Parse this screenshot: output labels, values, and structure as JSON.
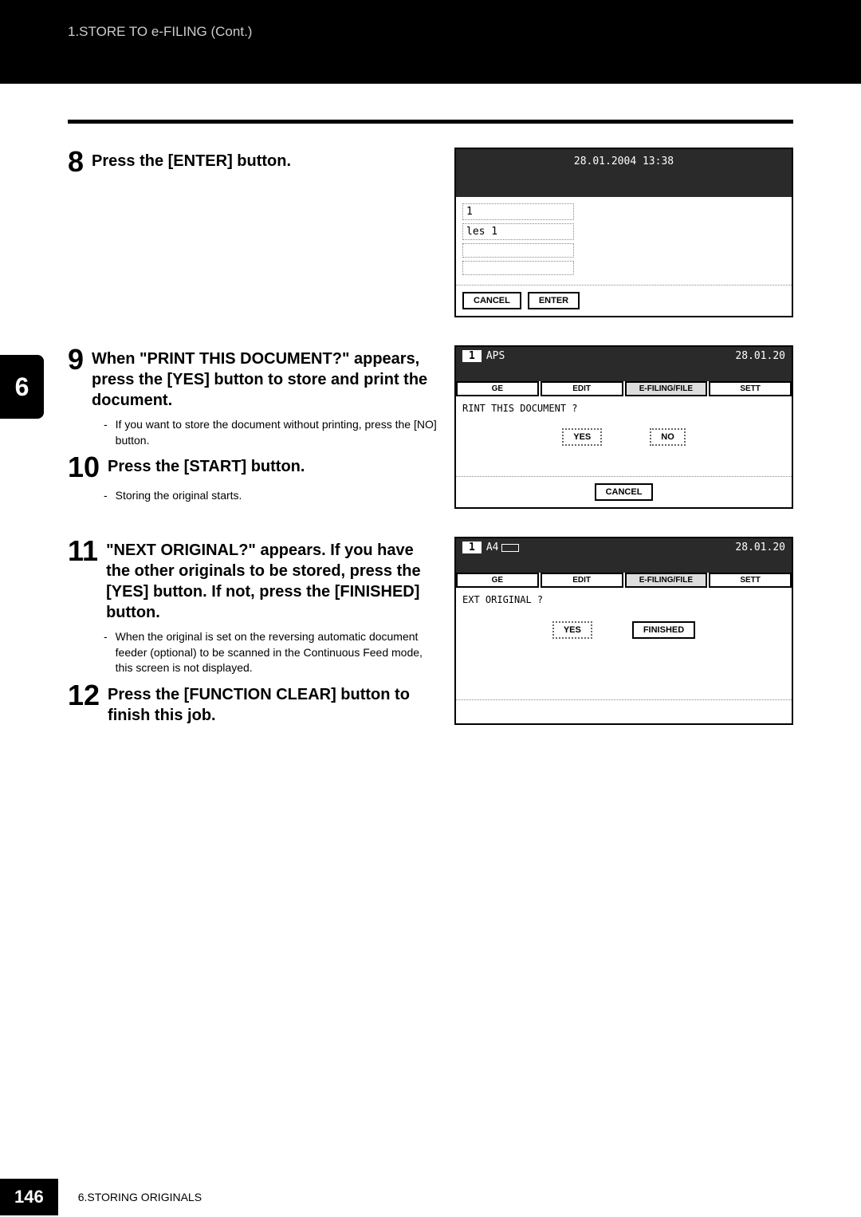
{
  "header": {
    "breadcrumb": "1.STORE TO e-FILING (Cont.)"
  },
  "chapterTab": "6",
  "steps": {
    "s8": {
      "num": "8",
      "title": "Press the [ENTER] button."
    },
    "s9": {
      "num": "9",
      "title": "When \"PRINT THIS DOCUMENT?\" appears, press the [YES] button to store and print the document.",
      "bullet1": "If you want to store the document without printing, press the [NO] button."
    },
    "s10": {
      "num": "10",
      "title": "Press the [START] button.",
      "bullet1": "Storing the original starts."
    },
    "s11": {
      "num": "11",
      "title": "\"NEXT ORIGINAL?\" appears. If you have the other originals to be stored, press the [YES] button. If not, press the [FINISHED] button.",
      "bullet1": "When the original is set on the reversing automatic document feeder (optional) to be scanned in the Continuous Feed mode, this screen is not displayed."
    },
    "s12": {
      "num": "12",
      "title": "Press the [FUNCTION CLEAR] button to finish this job."
    }
  },
  "screenshots": {
    "scr1": {
      "datetime": "28.01.2004 13:38",
      "field1": "1",
      "field2": "les 1",
      "btnCancel": "CANCEL",
      "btnEnter": "ENTER"
    },
    "scr2": {
      "badge": "1",
      "mode": "APS",
      "date": "28.01.20",
      "tab1": "GE",
      "tab2": "EDIT",
      "tab3": "E-FILING/FILE",
      "tab4": "SETT",
      "prompt": "RINT THIS DOCUMENT ?",
      "btnYes": "YES",
      "btnNo": "NO",
      "btnCancel": "CANCEL"
    },
    "scr3": {
      "badge": "1",
      "mode": "A4",
      "date": "28.01.20",
      "tab1": "GE",
      "tab2": "EDIT",
      "tab3": "E-FILING/FILE",
      "tab4": "SETT",
      "prompt": "EXT ORIGINAL ?",
      "btnYes": "YES",
      "btnFinished": "FINISHED"
    }
  },
  "footer": {
    "pageNum": "146",
    "chapter": "6.STORING ORIGINALS"
  }
}
